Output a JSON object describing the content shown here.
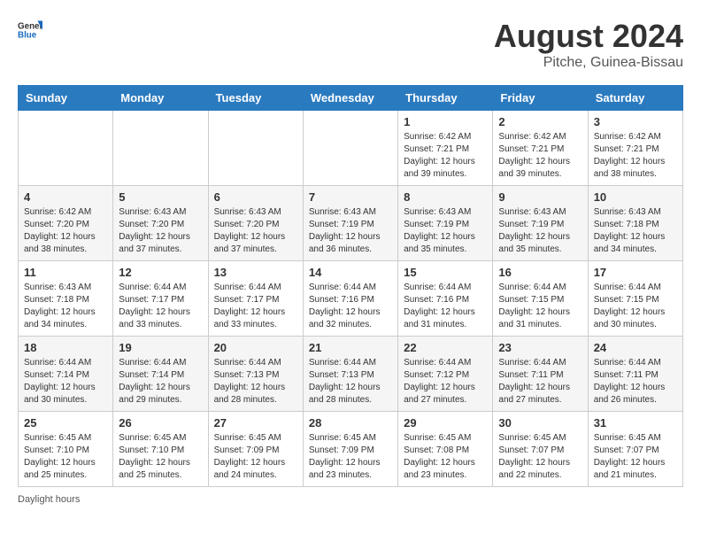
{
  "header": {
    "logo_general": "General",
    "logo_blue": "Blue",
    "title": "August 2024",
    "location": "Pitche, Guinea-Bissau"
  },
  "calendar": {
    "days_of_week": [
      "Sunday",
      "Monday",
      "Tuesday",
      "Wednesday",
      "Thursday",
      "Friday",
      "Saturday"
    ],
    "weeks": [
      [
        {
          "day": "",
          "info": ""
        },
        {
          "day": "",
          "info": ""
        },
        {
          "day": "",
          "info": ""
        },
        {
          "day": "",
          "info": ""
        },
        {
          "day": "1",
          "info": "Sunrise: 6:42 AM\nSunset: 7:21 PM\nDaylight: 12 hours and 39 minutes."
        },
        {
          "day": "2",
          "info": "Sunrise: 6:42 AM\nSunset: 7:21 PM\nDaylight: 12 hours and 39 minutes."
        },
        {
          "day": "3",
          "info": "Sunrise: 6:42 AM\nSunset: 7:21 PM\nDaylight: 12 hours and 38 minutes."
        }
      ],
      [
        {
          "day": "4",
          "info": "Sunrise: 6:42 AM\nSunset: 7:20 PM\nDaylight: 12 hours and 38 minutes."
        },
        {
          "day": "5",
          "info": "Sunrise: 6:43 AM\nSunset: 7:20 PM\nDaylight: 12 hours and 37 minutes."
        },
        {
          "day": "6",
          "info": "Sunrise: 6:43 AM\nSunset: 7:20 PM\nDaylight: 12 hours and 37 minutes."
        },
        {
          "day": "7",
          "info": "Sunrise: 6:43 AM\nSunset: 7:19 PM\nDaylight: 12 hours and 36 minutes."
        },
        {
          "day": "8",
          "info": "Sunrise: 6:43 AM\nSunset: 7:19 PM\nDaylight: 12 hours and 35 minutes."
        },
        {
          "day": "9",
          "info": "Sunrise: 6:43 AM\nSunset: 7:19 PM\nDaylight: 12 hours and 35 minutes."
        },
        {
          "day": "10",
          "info": "Sunrise: 6:43 AM\nSunset: 7:18 PM\nDaylight: 12 hours and 34 minutes."
        }
      ],
      [
        {
          "day": "11",
          "info": "Sunrise: 6:43 AM\nSunset: 7:18 PM\nDaylight: 12 hours and 34 minutes."
        },
        {
          "day": "12",
          "info": "Sunrise: 6:44 AM\nSunset: 7:17 PM\nDaylight: 12 hours and 33 minutes."
        },
        {
          "day": "13",
          "info": "Sunrise: 6:44 AM\nSunset: 7:17 PM\nDaylight: 12 hours and 33 minutes."
        },
        {
          "day": "14",
          "info": "Sunrise: 6:44 AM\nSunset: 7:16 PM\nDaylight: 12 hours and 32 minutes."
        },
        {
          "day": "15",
          "info": "Sunrise: 6:44 AM\nSunset: 7:16 PM\nDaylight: 12 hours and 31 minutes."
        },
        {
          "day": "16",
          "info": "Sunrise: 6:44 AM\nSunset: 7:15 PM\nDaylight: 12 hours and 31 minutes."
        },
        {
          "day": "17",
          "info": "Sunrise: 6:44 AM\nSunset: 7:15 PM\nDaylight: 12 hours and 30 minutes."
        }
      ],
      [
        {
          "day": "18",
          "info": "Sunrise: 6:44 AM\nSunset: 7:14 PM\nDaylight: 12 hours and 30 minutes."
        },
        {
          "day": "19",
          "info": "Sunrise: 6:44 AM\nSunset: 7:14 PM\nDaylight: 12 hours and 29 minutes."
        },
        {
          "day": "20",
          "info": "Sunrise: 6:44 AM\nSunset: 7:13 PM\nDaylight: 12 hours and 28 minutes."
        },
        {
          "day": "21",
          "info": "Sunrise: 6:44 AM\nSunset: 7:13 PM\nDaylight: 12 hours and 28 minutes."
        },
        {
          "day": "22",
          "info": "Sunrise: 6:44 AM\nSunset: 7:12 PM\nDaylight: 12 hours and 27 minutes."
        },
        {
          "day": "23",
          "info": "Sunrise: 6:44 AM\nSunset: 7:11 PM\nDaylight: 12 hours and 27 minutes."
        },
        {
          "day": "24",
          "info": "Sunrise: 6:44 AM\nSunset: 7:11 PM\nDaylight: 12 hours and 26 minutes."
        }
      ],
      [
        {
          "day": "25",
          "info": "Sunrise: 6:45 AM\nSunset: 7:10 PM\nDaylight: 12 hours and 25 minutes."
        },
        {
          "day": "26",
          "info": "Sunrise: 6:45 AM\nSunset: 7:10 PM\nDaylight: 12 hours and 25 minutes."
        },
        {
          "day": "27",
          "info": "Sunrise: 6:45 AM\nSunset: 7:09 PM\nDaylight: 12 hours and 24 minutes."
        },
        {
          "day": "28",
          "info": "Sunrise: 6:45 AM\nSunset: 7:09 PM\nDaylight: 12 hours and 23 minutes."
        },
        {
          "day": "29",
          "info": "Sunrise: 6:45 AM\nSunset: 7:08 PM\nDaylight: 12 hours and 23 minutes."
        },
        {
          "day": "30",
          "info": "Sunrise: 6:45 AM\nSunset: 7:07 PM\nDaylight: 12 hours and 22 minutes."
        },
        {
          "day": "31",
          "info": "Sunrise: 6:45 AM\nSunset: 7:07 PM\nDaylight: 12 hours and 21 minutes."
        }
      ]
    ]
  },
  "footer": {
    "note": "Daylight hours"
  }
}
